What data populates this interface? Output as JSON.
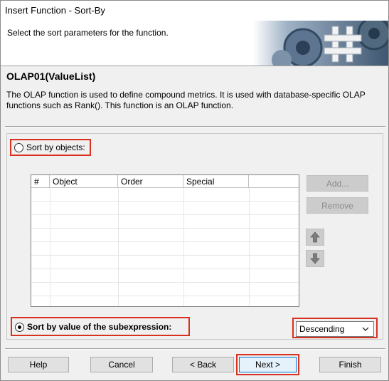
{
  "window": {
    "title": "Insert Function - Sort-By"
  },
  "header": {
    "instruction": "Select the sort parameters for the function."
  },
  "function": {
    "name": "OLAP01(ValueList)",
    "description": "The OLAP function is used to define compound metrics. It is used with database-specific OLAP functions such as Rank(). This function is an OLAP function."
  },
  "sort_by_objects": {
    "label": "Sort by objects:",
    "selected": false,
    "columns": [
      "#",
      "Object",
      "Order",
      "Special"
    ],
    "rows": [],
    "add_label": "Add...",
    "remove_label": "Remove",
    "move_up_icon": "arrow-up-icon",
    "move_down_icon": "arrow-down-icon"
  },
  "sort_by_subexpression": {
    "label": "Sort by value of the subexpression:",
    "selected": true,
    "order_value": "Descending"
  },
  "footer": {
    "help_label": "Help",
    "cancel_label": "Cancel",
    "back_label": "< Back",
    "next_label": "Next >",
    "finish_label": "Finish"
  },
  "colors": {
    "highlight": "#d9301f",
    "focus": "#0078d7"
  }
}
